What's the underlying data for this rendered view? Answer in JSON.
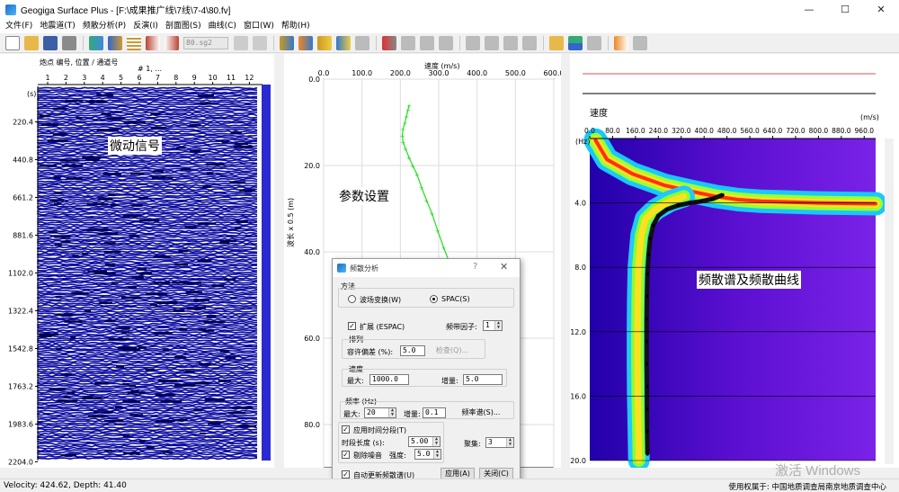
{
  "window": {
    "title": "Geogiga Surface Plus - [F:\\成果推广线\\7线\\7-4\\80.fv]",
    "minimize": "—",
    "maximize": "☐",
    "close": "✕"
  },
  "menu": [
    "文件(F)",
    "地震道(T)",
    "频散分析(P)",
    "反演(I)",
    "剖面图(S)",
    "曲线(C)",
    "窗口(W)",
    "帮助(H)"
  ],
  "toolbar": {
    "record_combo": "80.sg2"
  },
  "left_panel": {
    "header_label": "炮点 编号, 位置 / 通道号",
    "shot_label": "# 1, ...",
    "time_unit": "(s)",
    "trace_numbers": [
      "1",
      "2",
      "3",
      "4",
      "5",
      "6",
      "7",
      "8",
      "9",
      "10",
      "11",
      "12"
    ],
    "time_ticks": [
      "220.4",
      "440.8",
      "661.2",
      "881.6",
      "1102.0",
      "1322.4",
      "1542.8",
      "1763.2",
      "1983.6",
      "2204.0"
    ],
    "annotation": "微动信号",
    "trace_color": "#0a0aa0"
  },
  "mid_panel": {
    "x_title": "速度 (m/s)",
    "x_ticks": [
      "0.0",
      "100.0",
      "200.0",
      "300.0",
      "400.0",
      "500.0",
      "600.0"
    ],
    "y_ticks": [
      "0.0",
      "20.0",
      "40.0",
      "60.0",
      "80.0"
    ],
    "y_title": "波长 x 0.5 (m)",
    "annotation": "参数设置",
    "curve_color": "#22dd22"
  },
  "right_panel": {
    "title": "速度",
    "x_unit": "(m/s)",
    "y_unit": "(Hz)",
    "x_ticks": [
      "0.0",
      "80.0",
      "160.0",
      "240.0",
      "320.0",
      "400.0",
      "480.0",
      "560.0",
      "640.0",
      "720.0",
      "800.0",
      "880.0",
      "960.0"
    ],
    "y_ticks": [
      "4.0",
      "8.0",
      "12.0",
      "16.0",
      "20.0"
    ],
    "annotation": "频散谱及频散曲线"
  },
  "dialog": {
    "title": "频散分析",
    "help": "?",
    "close": "✕",
    "method_label": "方法",
    "radio_wavefield": "波场变换(W)",
    "radio_spac": "SPAC(S)",
    "espac_label": "扩展 (ESPAC)",
    "band_factor_label": "频带因子:",
    "band_factor_value": "1",
    "arrange_label": "排列",
    "tolerance_label": "容许偏差 (%):",
    "tolerance_value": "5.0",
    "check_button": "检查(Q)...",
    "velocity_label": "速度",
    "vmax_label": "最大:",
    "vmax_value": "1000.0",
    "vinc_label": "增量:",
    "vinc_value": "5.0",
    "freq_label": "频率 (Hz)",
    "fmax_label": "最大:",
    "fmax_value": "20",
    "finc_label": "增量:",
    "finc_value": "0.1",
    "spectrum_button": "频率谱(S)...",
    "time_segment_label": "应用时间分段(T)",
    "segment_length_label": "时段长度 (s):",
    "segment_length_value": "5.00",
    "stack_label": "聚集:",
    "stack_value": "3",
    "denoise_label": "剔除噪音",
    "strength_label": "强度:",
    "strength_value": "5.0",
    "auto_update_label": "自动更新频散谱(U)",
    "apply_button": "应用(A)",
    "close_button": "关闭(C)"
  },
  "status": {
    "left": "Velocity: 424.62, Depth: 41.40",
    "right": "使用权属于: 中国地质调查局南京地质调查中心",
    "watermark": "激活 Windows"
  }
}
